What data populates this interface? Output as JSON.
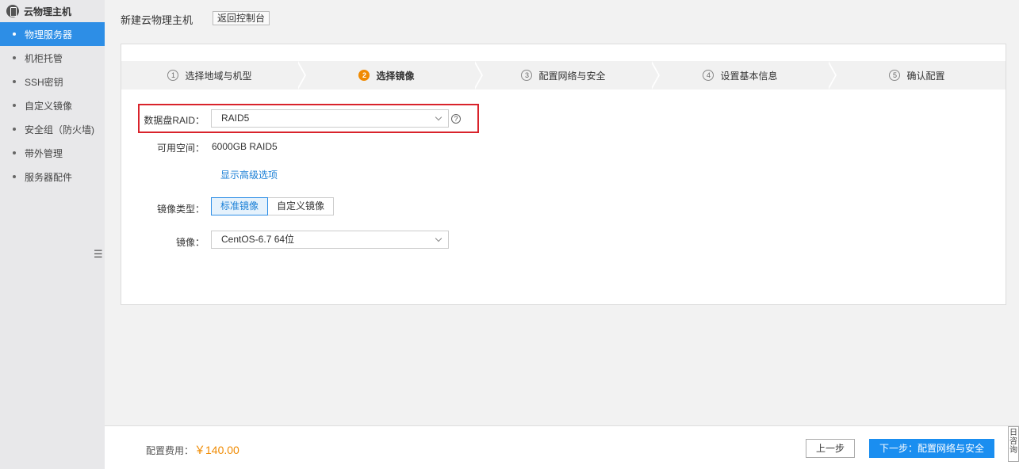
{
  "sidebar": {
    "title": "云物理主机",
    "items": [
      {
        "label": "物理服务器",
        "active": true
      },
      {
        "label": "机柜托管"
      },
      {
        "label": "SSH密钥"
      },
      {
        "label": "自定义镜像"
      },
      {
        "label": "安全组（防火墙)"
      },
      {
        "label": "带外管理"
      },
      {
        "label": "服务器配件"
      }
    ]
  },
  "header": {
    "title": "新建云物理主机",
    "back_label": "返回控制台"
  },
  "steps": [
    {
      "num": "1",
      "label": "选择地域与机型"
    },
    {
      "num": "2",
      "label": "选择镜像",
      "active": true
    },
    {
      "num": "3",
      "label": "配置网络与安全"
    },
    {
      "num": "4",
      "label": "设置基本信息"
    },
    {
      "num": "5",
      "label": "确认配置"
    }
  ],
  "form": {
    "raid_label": "数据盘RAID：",
    "raid_value": "RAID5",
    "help_glyph": "?",
    "space_label": "可用空间：",
    "space_value": "6000GB RAID5",
    "advanced_link": "显示高级选项",
    "image_type_label": "镜像类型：",
    "image_types": [
      "标准镜像",
      "自定义镜像"
    ],
    "image_label": "镜像：",
    "image_value": "CentOS-6.7 64位"
  },
  "footer": {
    "fee_label": "配置费用：",
    "fee_value": "￥140.00",
    "prev_label": "上一步",
    "next_label": "下一步：配置网络与安全",
    "consult_label": "咨询",
    "consult_glyph": "日"
  },
  "colors": {
    "accent": "#2d8ee6",
    "highlight": "#d9232b",
    "price": "#f08a00"
  }
}
